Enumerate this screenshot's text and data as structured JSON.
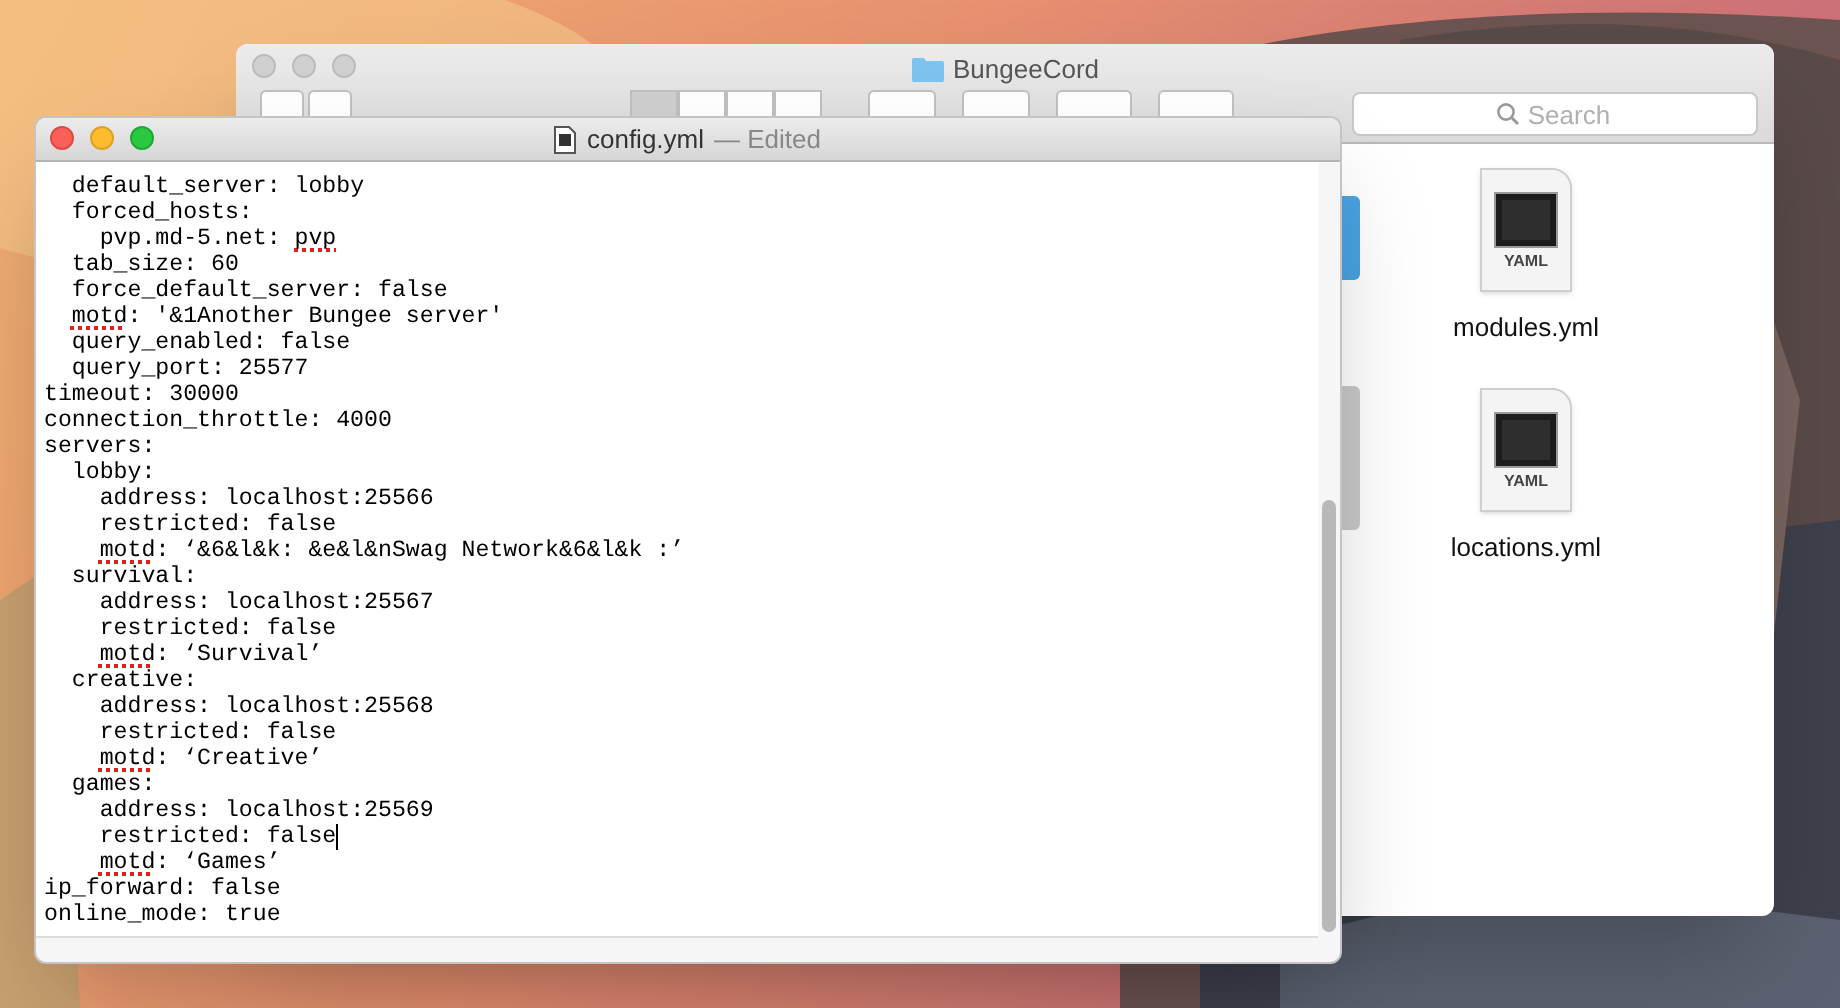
{
  "finder": {
    "title": "BungeeCord",
    "search": {
      "placeholder": "Search"
    },
    "view_buttons": [
      {
        "selected": true
      },
      {
        "selected": false
      },
      {
        "selected": false
      },
      {
        "selected": false
      }
    ],
    "files": [
      {
        "name": "modules.yml",
        "type": "YAML"
      },
      {
        "name": "locations.yml",
        "type": "YAML"
      }
    ]
  },
  "editor": {
    "title": "config.yml",
    "status": "— Edited",
    "lines": [
      {
        "segments": [
          {
            "text": "  default_server: lobby"
          }
        ]
      },
      {
        "segments": [
          {
            "text": "  forced_hosts:"
          }
        ]
      },
      {
        "segments": [
          {
            "text": "    pvp.md-5.net: "
          },
          {
            "text": "pvp",
            "misspelled": true
          }
        ]
      },
      {
        "segments": [
          {
            "text": "  tab_size: 60"
          }
        ]
      },
      {
        "segments": [
          {
            "text": "  force_default_server: false"
          }
        ]
      },
      {
        "segments": [
          {
            "text": "  motd",
            "misspelled": true
          },
          {
            "text": ": '&1Another Bungee server'"
          }
        ]
      },
      {
        "segments": [
          {
            "text": "  query_enabled: false"
          }
        ]
      },
      {
        "segments": [
          {
            "text": "  query_port: 25577"
          }
        ]
      },
      {
        "segments": [
          {
            "text": "timeout: 30000"
          }
        ]
      },
      {
        "segments": [
          {
            "text": "connection_throttle: 4000"
          }
        ]
      },
      {
        "segments": [
          {
            "text": "servers:"
          }
        ]
      },
      {
        "segments": [
          {
            "text": "  lobby:"
          }
        ]
      },
      {
        "segments": [
          {
            "text": "    address: localhost:25566"
          }
        ]
      },
      {
        "segments": [
          {
            "text": "    restricted: false"
          }
        ]
      },
      {
        "segments": [
          {
            "text": "    motd",
            "misspelled": true
          },
          {
            "text": ": ‘&6&l&k: &e&l&nSwag Network&6&l&k :’"
          }
        ]
      },
      {
        "segments": [
          {
            "text": "  survival:"
          }
        ]
      },
      {
        "segments": [
          {
            "text": "    address: localhost:25567"
          }
        ]
      },
      {
        "segments": [
          {
            "text": "    restricted: false"
          }
        ]
      },
      {
        "segments": [
          {
            "text": "    motd",
            "misspelled": true
          },
          {
            "text": ": ‘Survival’"
          }
        ]
      },
      {
        "segments": [
          {
            "text": "  creative:"
          }
        ]
      },
      {
        "segments": [
          {
            "text": "    address: localhost:25568"
          }
        ]
      },
      {
        "segments": [
          {
            "text": "    restricted: false"
          }
        ]
      },
      {
        "segments": [
          {
            "text": "    motd",
            "misspelled": true
          },
          {
            "text": ": ‘Creative’"
          }
        ]
      },
      {
        "segments": [
          {
            "text": "  games:"
          }
        ]
      },
      {
        "segments": [
          {
            "text": "    address: localhost:25569"
          }
        ]
      },
      {
        "segments": [
          {
            "text": "    restricted: false"
          }
        ],
        "caret": true
      },
      {
        "segments": [
          {
            "text": "    motd",
            "misspelled": true
          },
          {
            "text": ": ‘Games’"
          }
        ]
      },
      {
        "segments": [
          {
            "text": "ip_forward: false"
          }
        ]
      },
      {
        "segments": [
          {
            "text": "online_mode: true"
          }
        ]
      }
    ]
  }
}
